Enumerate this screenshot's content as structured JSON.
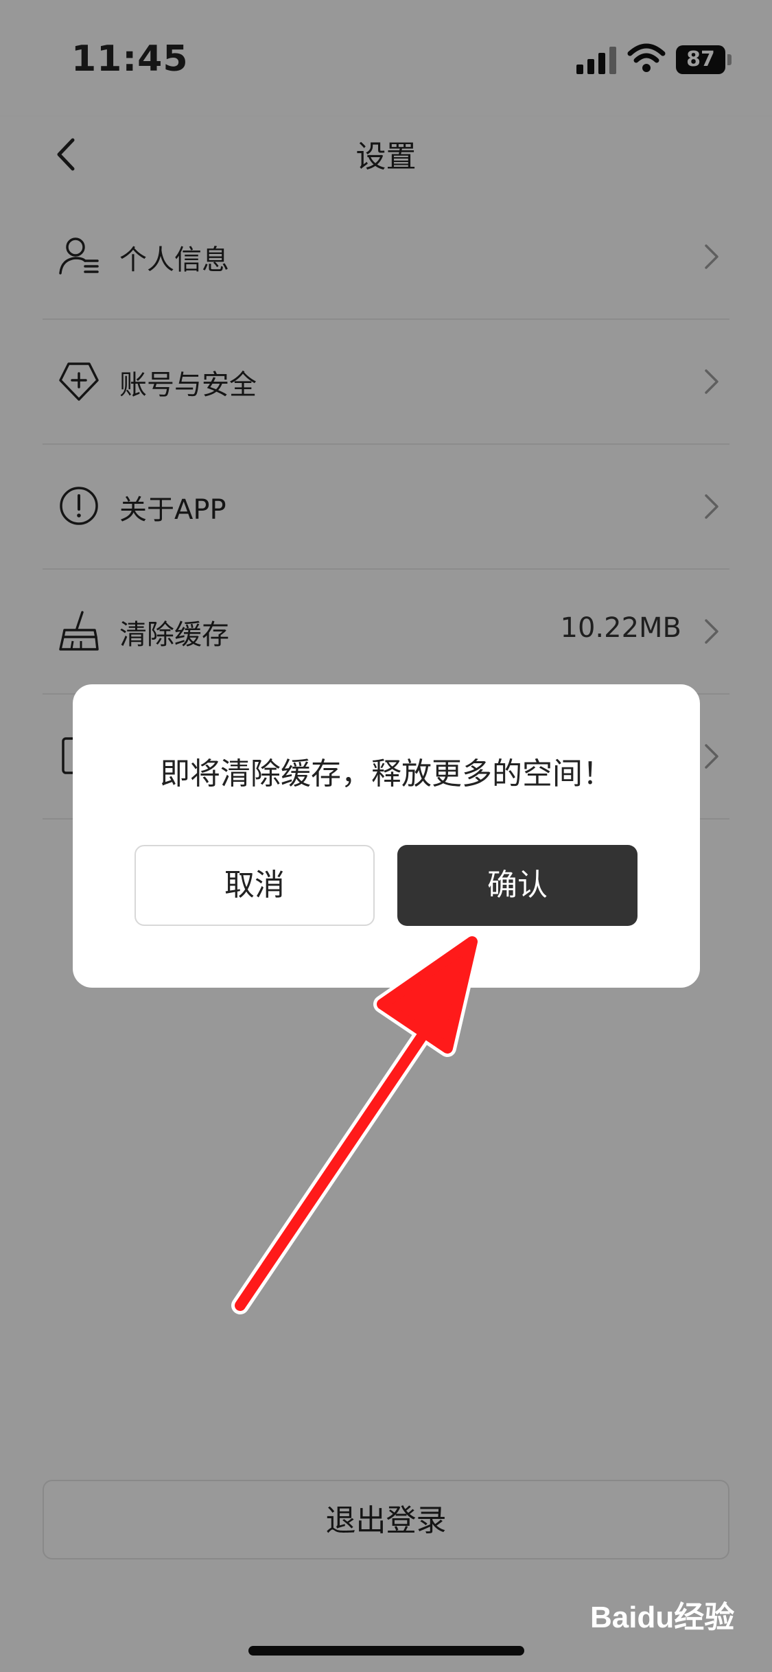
{
  "status_bar": {
    "time": "11:45",
    "battery": "87"
  },
  "nav": {
    "title": "设置"
  },
  "settings": [
    {
      "label": "个人信息",
      "value": "",
      "icon": "user-info-icon"
    },
    {
      "label": "账号与安全",
      "value": "",
      "icon": "shield-plus-icon"
    },
    {
      "label": "关于APP",
      "value": "",
      "icon": "info-circle-icon"
    },
    {
      "label": "清除缓存",
      "value": "10.22MB",
      "icon": "broom-icon"
    }
  ],
  "logout": {
    "label": "退出登录"
  },
  "dialog": {
    "message": "即将清除缓存，释放更多的空间！",
    "cancel_label": "取消",
    "confirm_label": "确认"
  },
  "watermark": "Baidu经验",
  "colors": {
    "annotation_arrow": "#ff1a1a",
    "confirm_button": "#333333"
  }
}
